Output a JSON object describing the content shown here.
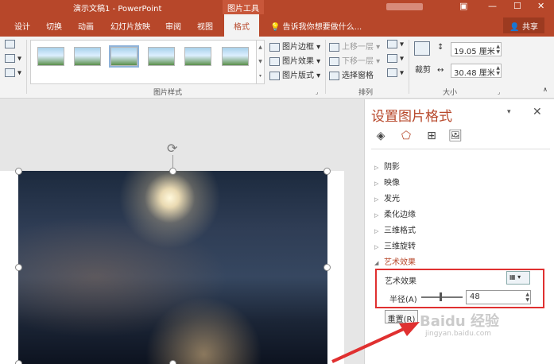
{
  "titlebar": {
    "document_title": "演示文稿1 - PowerPoint",
    "context_tool": "图片工具"
  },
  "tabs": [
    "设计",
    "切换",
    "动画",
    "幻灯片放映",
    "审阅",
    "视图",
    "格式"
  ],
  "tell_me": "告诉我你想要做什么...",
  "share": "共享",
  "ribbon": {
    "picture_border": "图片边框",
    "picture_effects": "图片效果",
    "picture_layout": "图片版式",
    "picture_styles_label": "图片样式",
    "bring_forward": "上移一层",
    "send_backward": "下移一层",
    "selection_pane": "选择窗格",
    "arrange_label": "排列",
    "crop": "裁剪",
    "height": "19.05 厘米",
    "width": "30.48 厘米",
    "size_label": "大小"
  },
  "pane": {
    "title": "设置图片格式",
    "sections": [
      "阴影",
      "映像",
      "发光",
      "柔化边缘",
      "三维格式",
      "三维旋转",
      "艺术效果"
    ],
    "art_effect_label": "艺术效果",
    "radius_label": "半径(A)",
    "radius_value": "48",
    "reset_button": "重置(R)"
  },
  "watermark": {
    "text": "Baidu 经验",
    "url": "jingyan.baidu.com"
  },
  "colors": {
    "accent": "#b7472a",
    "highlight_box": "#e03030"
  }
}
